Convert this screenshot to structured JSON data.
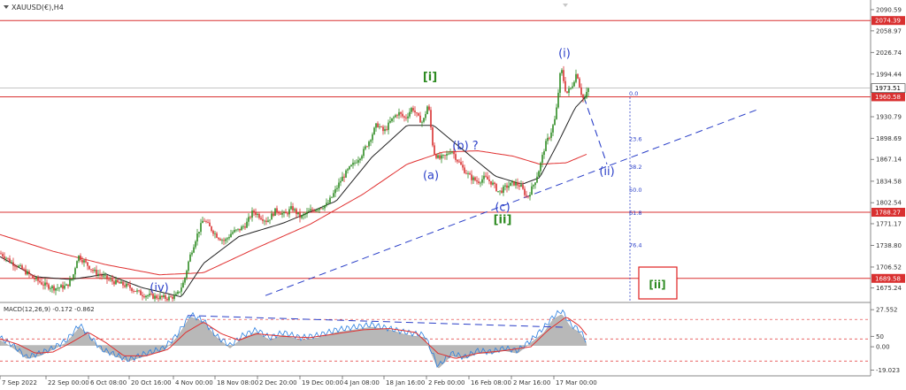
{
  "chart_data": {
    "type": "candlestick-elliott-wave",
    "title": "XAUUSD(€),H4",
    "price_axis": {
      "ylim": [
        1655,
        2105
      ],
      "ticks": [
        "2090.59",
        "2058.97",
        "2026.74",
        "1994.44",
        "1930.79",
        "1898.69",
        "1867.14",
        "1834.58",
        "1802.54",
        "1771.17",
        "1738.80",
        "1706.52",
        "1675.24"
      ]
    },
    "price_series": [
      {
        "t": 0,
        "p": 1727
      },
      {
        "t": 6,
        "p": 1722
      },
      {
        "t": 12,
        "p": 1714
      },
      {
        "t": 20,
        "p": 1708
      },
      {
        "t": 28,
        "p": 1700
      },
      {
        "t": 38,
        "p": 1690
      },
      {
        "t": 50,
        "p": 1680
      },
      {
        "t": 62,
        "p": 1675
      },
      {
        "t": 75,
        "p": 1678
      },
      {
        "t": 82,
        "p": 1690
      },
      {
        "t": 88,
        "p": 1724
      },
      {
        "t": 94,
        "p": 1716
      },
      {
        "t": 100,
        "p": 1708
      },
      {
        "t": 106,
        "p": 1700
      },
      {
        "t": 114,
        "p": 1694
      },
      {
        "t": 122,
        "p": 1688
      },
      {
        "t": 132,
        "p": 1683
      },
      {
        "t": 144,
        "p": 1678
      },
      {
        "t": 160,
        "p": 1666
      },
      {
        "t": 175,
        "p": 1662
      },
      {
        "t": 190,
        "p": 1660
      },
      {
        "t": 200,
        "p": 1664
      },
      {
        "t": 208,
        "p": 1685
      },
      {
        "t": 214,
        "p": 1720
      },
      {
        "t": 222,
        "p": 1752
      },
      {
        "t": 230,
        "p": 1778
      },
      {
        "t": 238,
        "p": 1764
      },
      {
        "t": 246,
        "p": 1752
      },
      {
        "t": 254,
        "p": 1745
      },
      {
        "t": 262,
        "p": 1758
      },
      {
        "t": 270,
        "p": 1762
      },
      {
        "t": 278,
        "p": 1770
      },
      {
        "t": 286,
        "p": 1790
      },
      {
        "t": 294,
        "p": 1782
      },
      {
        "t": 302,
        "p": 1775
      },
      {
        "t": 312,
        "p": 1792
      },
      {
        "t": 322,
        "p": 1784
      },
      {
        "t": 330,
        "p": 1795
      },
      {
        "t": 340,
        "p": 1780
      },
      {
        "t": 350,
        "p": 1790
      },
      {
        "t": 360,
        "p": 1795
      },
      {
        "t": 370,
        "p": 1800
      },
      {
        "t": 378,
        "p": 1818
      },
      {
        "t": 386,
        "p": 1838
      },
      {
        "t": 394,
        "p": 1852
      },
      {
        "t": 402,
        "p": 1864
      },
      {
        "t": 410,
        "p": 1877
      },
      {
        "t": 418,
        "p": 1897
      },
      {
        "t": 426,
        "p": 1920
      },
      {
        "t": 434,
        "p": 1908
      },
      {
        "t": 442,
        "p": 1925
      },
      {
        "t": 450,
        "p": 1937
      },
      {
        "t": 458,
        "p": 1928
      },
      {
        "t": 466,
        "p": 1945
      },
      {
        "t": 472,
        "p": 1930
      },
      {
        "t": 478,
        "p": 1922
      },
      {
        "t": 484,
        "p": 1951
      },
      {
        "t": 490,
        "p": 1878
      },
      {
        "t": 496,
        "p": 1868
      },
      {
        "t": 504,
        "p": 1872
      },
      {
        "t": 510,
        "p": 1882
      },
      {
        "t": 516,
        "p": 1868
      },
      {
        "t": 524,
        "p": 1852
      },
      {
        "t": 532,
        "p": 1840
      },
      {
        "t": 540,
        "p": 1834
      },
      {
        "t": 548,
        "p": 1840
      },
      {
        "t": 556,
        "p": 1832
      },
      {
        "t": 564,
        "p": 1818
      },
      {
        "t": 572,
        "p": 1826
      },
      {
        "t": 580,
        "p": 1832
      },
      {
        "t": 588,
        "p": 1828
      },
      {
        "t": 596,
        "p": 1810
      },
      {
        "t": 604,
        "p": 1832
      },
      {
        "t": 610,
        "p": 1855
      },
      {
        "t": 616,
        "p": 1888
      },
      {
        "t": 622,
        "p": 1905
      },
      {
        "t": 628,
        "p": 1930
      },
      {
        "t": 634,
        "p": 2005
      },
      {
        "t": 640,
        "p": 1965
      },
      {
        "t": 646,
        "p": 1975
      },
      {
        "t": 652,
        "p": 1998
      },
      {
        "t": 656,
        "p": 1970
      },
      {
        "t": 660,
        "p": 1955
      },
      {
        "t": 665,
        "p": 1972
      }
    ],
    "ma_fast": [
      {
        "t": 0,
        "p": 1722
      },
      {
        "t": 40,
        "p": 1692
      },
      {
        "t": 80,
        "p": 1688
      },
      {
        "t": 120,
        "p": 1696
      },
      {
        "t": 160,
        "p": 1676
      },
      {
        "t": 205,
        "p": 1662
      },
      {
        "t": 230,
        "p": 1712
      },
      {
        "t": 270,
        "p": 1752
      },
      {
        "t": 320,
        "p": 1772
      },
      {
        "t": 380,
        "p": 1805
      },
      {
        "t": 420,
        "p": 1870
      },
      {
        "t": 460,
        "p": 1918
      },
      {
        "t": 490,
        "p": 1918
      },
      {
        "t": 520,
        "p": 1885
      },
      {
        "t": 560,
        "p": 1842
      },
      {
        "t": 590,
        "p": 1830
      },
      {
        "t": 610,
        "p": 1840
      },
      {
        "t": 630,
        "p": 1890
      },
      {
        "t": 650,
        "p": 1944
      },
      {
        "t": 665,
        "p": 1965
      }
    ],
    "ma_slow": [
      {
        "t": 0,
        "p": 1755
      },
      {
        "t": 60,
        "p": 1730
      },
      {
        "t": 120,
        "p": 1710
      },
      {
        "t": 180,
        "p": 1695
      },
      {
        "t": 230,
        "p": 1698
      },
      {
        "t": 290,
        "p": 1735
      },
      {
        "t": 350,
        "p": 1770
      },
      {
        "t": 410,
        "p": 1815
      },
      {
        "t": 460,
        "p": 1860
      },
      {
        "t": 500,
        "p": 1878
      },
      {
        "t": 540,
        "p": 1880
      },
      {
        "t": 580,
        "p": 1872
      },
      {
        "t": 610,
        "p": 1860
      },
      {
        "t": 640,
        "p": 1862
      },
      {
        "t": 665,
        "p": 1876
      }
    ],
    "horizontal_levels": [
      {
        "price": 2074.39,
        "label": "2074.39"
      },
      {
        "price": 1960.58,
        "label": "1960.58"
      },
      {
        "price": 1788.27,
        "label": "1788.27"
      },
      {
        "price": 1689.58,
        "label": "1689.58"
      }
    ],
    "current_price": {
      "price": 1973.51,
      "label": "1973.51"
    },
    "trendline": {
      "from": {
        "t": 300,
        "p": 1664
      },
      "to": {
        "t": 855,
        "p": 1941
      }
    },
    "projection": [
      {
        "t": 660,
        "p": 1960
      },
      {
        "t": 686,
        "p": 1860
      }
    ],
    "fib_retracement": {
      "t": 712,
      "from_price": 1960,
      "to_price": 1672,
      "levels": [
        {
          "ratio": 0,
          "label": "0.0"
        },
        {
          "ratio": 0.236,
          "label": "23.6"
        },
        {
          "ratio": 0.382,
          "label": "38.2"
        },
        {
          "ratio": 0.5,
          "label": "50.0"
        },
        {
          "ratio": 0.618,
          "label": "61.8"
        },
        {
          "ratio": 0.786,
          "label": "76.4"
        }
      ]
    },
    "wave_labels": [
      {
        "text": "[i]",
        "t": 486,
        "p": 1985,
        "color": "#2e8b22"
      },
      {
        "text": "(i)",
        "t": 638,
        "p": 2020,
        "color": "#2a3fc8"
      },
      {
        "text": "(b) ?",
        "t": 526,
        "p": 1882,
        "color": "#2a3fc8"
      },
      {
        "text": "(a)",
        "t": 487,
        "p": 1838,
        "color": "#2a3fc8"
      },
      {
        "text": "(c)",
        "t": 568,
        "p": 1790,
        "color": "#2a3fc8"
      },
      {
        "text": "[ii]",
        "t": 568,
        "p": 1772,
        "color": "#2e8b22"
      },
      {
        "text": "(ii)",
        "t": 686,
        "p": 1844,
        "color": "#2a3fc8"
      },
      {
        "text": "(iv)",
        "t": 180,
        "p": 1670,
        "color": "#2a3fc8"
      }
    ],
    "target_box": {
      "label": "[ii]",
      "color": "#2e8b22",
      "border": "#e02020"
    },
    "time_axis": [
      {
        "t": -2,
        "label": "7 Sep 2022"
      },
      {
        "t": 52,
        "label": "22 Sep 00:00"
      },
      {
        "t": 100,
        "label": "6 Oct 08:00"
      },
      {
        "t": 146,
        "label": "20 Oct 16:00"
      },
      {
        "t": 196,
        "label": "4 Nov 00:00"
      },
      {
        "t": 243,
        "label": "18 Nov 08:00"
      },
      {
        "t": 291,
        "label": "2 Dec 20:00"
      },
      {
        "t": 339,
        "label": "19 Dec 00:00"
      },
      {
        "t": 387,
        "label": "4 Jan 08:00"
      },
      {
        "t": 434,
        "label": "18 Jan 16:00"
      },
      {
        "t": 482,
        "label": "2 Feb 00:00"
      },
      {
        "t": 530,
        "label": "16 Feb 08:00"
      },
      {
        "t": 578,
        "label": "2 Mar 16:00"
      },
      {
        "t": 626,
        "label": "17 Mar 00:00"
      }
    ],
    "macd": {
      "header": "MACD(12,26,9) -0.172 -0.862",
      "ylim": [
        -22,
        31
      ],
      "ticks": [
        "27.552",
        "50",
        "0.00",
        "-19.023"
      ],
      "tick_values": [
        27.5,
        7,
        -1,
        -19
      ],
      "dotted_levels": [
        20,
        5,
        -12
      ],
      "histogram": [
        {
          "t": 0,
          "v": 4
        },
        {
          "t": 15,
          "v": -2
        },
        {
          "t": 30,
          "v": -10
        },
        {
          "t": 45,
          "v": -8
        },
        {
          "t": 60,
          "v": -3
        },
        {
          "t": 75,
          "v": 2
        },
        {
          "t": 90,
          "v": 14
        },
        {
          "t": 100,
          "v": 8
        },
        {
          "t": 115,
          "v": -4
        },
        {
          "t": 130,
          "v": -8
        },
        {
          "t": 145,
          "v": -12
        },
        {
          "t": 165,
          "v": -8
        },
        {
          "t": 185,
          "v": -4
        },
        {
          "t": 200,
          "v": 6
        },
        {
          "t": 215,
          "v": 22
        },
        {
          "t": 230,
          "v": 18
        },
        {
          "t": 245,
          "v": 6
        },
        {
          "t": 260,
          "v": -2
        },
        {
          "t": 275,
          "v": 6
        },
        {
          "t": 290,
          "v": 10
        },
        {
          "t": 305,
          "v": 4
        },
        {
          "t": 320,
          "v": 8
        },
        {
          "t": 340,
          "v": 4
        },
        {
          "t": 360,
          "v": 6
        },
        {
          "t": 380,
          "v": 10
        },
        {
          "t": 400,
          "v": 12
        },
        {
          "t": 420,
          "v": 14
        },
        {
          "t": 440,
          "v": 12
        },
        {
          "t": 460,
          "v": 8
        },
        {
          "t": 480,
          "v": 6
        },
        {
          "t": 495,
          "v": -18
        },
        {
          "t": 510,
          "v": -8
        },
        {
          "t": 525,
          "v": -10
        },
        {
          "t": 540,
          "v": -6
        },
        {
          "t": 555,
          "v": -6
        },
        {
          "t": 570,
          "v": -4
        },
        {
          "t": 585,
          "v": -6
        },
        {
          "t": 600,
          "v": 2
        },
        {
          "t": 615,
          "v": 10
        },
        {
          "t": 625,
          "v": 20
        },
        {
          "t": 635,
          "v": 24
        },
        {
          "t": 645,
          "v": 14
        },
        {
          "t": 655,
          "v": 10
        },
        {
          "t": 663,
          "v": 2
        }
      ],
      "macd_line": [
        {
          "t": 0,
          "v": 6
        },
        {
          "t": 15,
          "v": 0
        },
        {
          "t": 30,
          "v": -9
        },
        {
          "t": 45,
          "v": -6
        },
        {
          "t": 60,
          "v": -2
        },
        {
          "t": 75,
          "v": 4
        },
        {
          "t": 90,
          "v": 16
        },
        {
          "t": 100,
          "v": 8
        },
        {
          "t": 115,
          "v": -3
        },
        {
          "t": 130,
          "v": -7
        },
        {
          "t": 145,
          "v": -11
        },
        {
          "t": 165,
          "v": -6
        },
        {
          "t": 185,
          "v": -2
        },
        {
          "t": 200,
          "v": 8
        },
        {
          "t": 215,
          "v": 24
        },
        {
          "t": 230,
          "v": 19
        },
        {
          "t": 245,
          "v": 7
        },
        {
          "t": 260,
          "v": 0
        },
        {
          "t": 275,
          "v": 8
        },
        {
          "t": 290,
          "v": 12
        },
        {
          "t": 305,
          "v": 6
        },
        {
          "t": 320,
          "v": 10
        },
        {
          "t": 340,
          "v": 6
        },
        {
          "t": 360,
          "v": 8
        },
        {
          "t": 380,
          "v": 12
        },
        {
          "t": 400,
          "v": 14
        },
        {
          "t": 420,
          "v": 16
        },
        {
          "t": 440,
          "v": 13
        },
        {
          "t": 460,
          "v": 10
        },
        {
          "t": 480,
          "v": 8
        },
        {
          "t": 495,
          "v": -16
        },
        {
          "t": 510,
          "v": -6
        },
        {
          "t": 525,
          "v": -9
        },
        {
          "t": 540,
          "v": -4
        },
        {
          "t": 555,
          "v": -5
        },
        {
          "t": 570,
          "v": -2
        },
        {
          "t": 585,
          "v": -4
        },
        {
          "t": 600,
          "v": 4
        },
        {
          "t": 615,
          "v": 14
        },
        {
          "t": 625,
          "v": 22
        },
        {
          "t": 635,
          "v": 27
        },
        {
          "t": 645,
          "v": 16
        },
        {
          "t": 655,
          "v": 12
        },
        {
          "t": 663,
          "v": 3
        }
      ],
      "signal_line": [
        {
          "t": 0,
          "v": 5
        },
        {
          "t": 20,
          "v": 1
        },
        {
          "t": 40,
          "v": -6
        },
        {
          "t": 60,
          "v": -5
        },
        {
          "t": 80,
          "v": 2
        },
        {
          "t": 100,
          "v": 10
        },
        {
          "t": 120,
          "v": 2
        },
        {
          "t": 140,
          "v": -8
        },
        {
          "t": 165,
          "v": -8
        },
        {
          "t": 190,
          "v": -3
        },
        {
          "t": 210,
          "v": 10
        },
        {
          "t": 230,
          "v": 18
        },
        {
          "t": 250,
          "v": 9
        },
        {
          "t": 270,
          "v": 4
        },
        {
          "t": 290,
          "v": 9
        },
        {
          "t": 320,
          "v": 7
        },
        {
          "t": 350,
          "v": 6
        },
        {
          "t": 380,
          "v": 9
        },
        {
          "t": 410,
          "v": 12
        },
        {
          "t": 440,
          "v": 13
        },
        {
          "t": 470,
          "v": 10
        },
        {
          "t": 495,
          "v": -6
        },
        {
          "t": 515,
          "v": -10
        },
        {
          "t": 540,
          "v": -6
        },
        {
          "t": 570,
          "v": -4
        },
        {
          "t": 600,
          "v": -1
        },
        {
          "t": 620,
          "v": 12
        },
        {
          "t": 640,
          "v": 22
        },
        {
          "t": 655,
          "v": 15
        },
        {
          "t": 663,
          "v": 8
        }
      ],
      "divergence_line": {
        "from": {
          "t": 212,
          "v": 23
        },
        "to": {
          "t": 636,
          "v": 14
        }
      }
    }
  }
}
